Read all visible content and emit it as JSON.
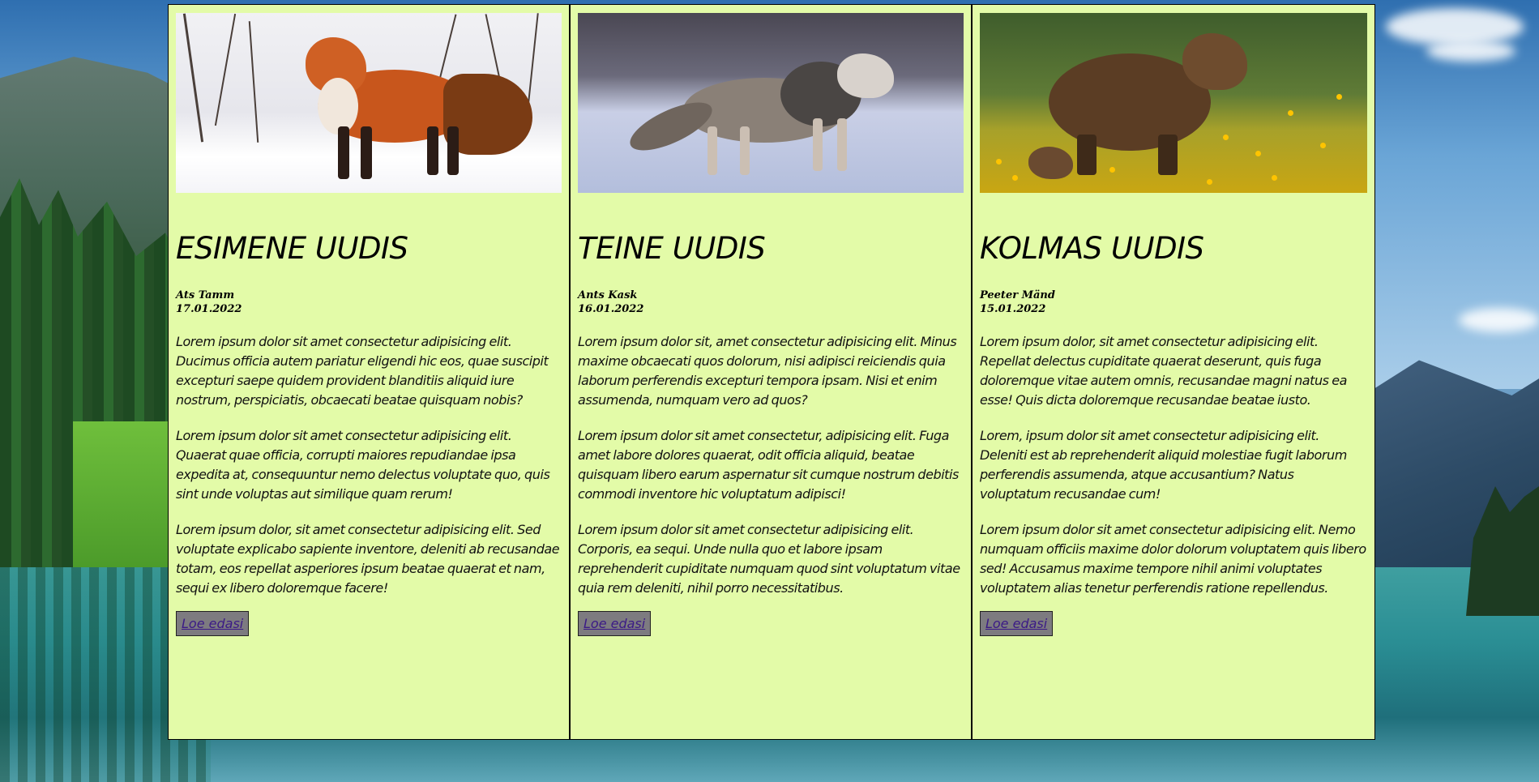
{
  "articles": [
    {
      "image": "fox-photo",
      "title": "ESIMENE UUDIS",
      "author": "Ats Tamm",
      "date": "17.01.2022",
      "paragraphs": [
        "Lorem ipsum dolor sit amet consectetur adipisicing elit. Ducimus officia autem pariatur eligendi hic eos, quae suscipit excepturi saepe quidem provident blanditiis aliquid iure nostrum, perspiciatis, obcaecati beatae quisquam nobis?",
        "Lorem ipsum dolor sit amet consectetur adipisicing elit. Quaerat quae officia, corrupti maiores repudiandae ipsa expedita at, consequuntur nemo delectus voluptate quo, quis sint unde voluptas aut similique quam rerum!",
        "Lorem ipsum dolor, sit amet consectetur adipisicing elit. Sed voluptate explicabo sapiente inventore, deleniti ab recusandae totam, eos repellat asperiores ipsum beatae quaerat et nam, sequi ex libero doloremque facere!"
      ],
      "read_more": "Loe edasi"
    },
    {
      "image": "wolf-photo",
      "title": "TEINE UUDIS",
      "author": "Ants Kask",
      "date": "16.01.2022",
      "paragraphs": [
        "Lorem ipsum dolor sit, amet consectetur adipisicing elit. Minus maxime obcaecati quos dolorum, nisi adipisci reiciendis quia laborum perferendis excepturi tempora ipsam. Nisi et enim assumenda, numquam vero ad quos?",
        "Lorem ipsum dolor sit amet consectetur, adipisicing elit. Fuga amet labore dolores quaerat, odit officia aliquid, beatae quisquam libero earum aspernatur sit cumque nostrum debitis commodi inventore hic voluptatum adipisci!",
        "Lorem ipsum dolor sit amet consectetur adipisicing elit. Corporis, ea sequi. Unde nulla quo et labore ipsam reprehenderit cupiditate numquam quod sint voluptatum vitae quia rem deleniti, nihil porro necessitatibus."
      ],
      "read_more": "Loe edasi"
    },
    {
      "image": "bear-photo",
      "title": "KOLMAS UUDIS",
      "author": "Peeter Mänd",
      "date": "15.01.2022",
      "paragraphs": [
        "Lorem ipsum dolor, sit amet consectetur adipisicing elit. Repellat delectus cupiditate quaerat deserunt, quis fuga doloremque vitae autem omnis, recusandae magni natus ea esse! Quis dicta doloremque recusandae beatae iusto.",
        "Lorem, ipsum dolor sit amet consectetur adipisicing elit. Deleniti est ab reprehenderit aliquid molestiae fugit laborum perferendis assumenda, atque accusantium? Natus voluptatum recusandae cum!",
        "Lorem ipsum dolor sit amet consectetur adipisicing elit. Nemo numquam officiis maxime dolor dolorum voluptatem quis libero sed! Accusamus maxime tempore nihil animi voluptates voluptatem alias tenetur perferendis ratione repellendus."
      ],
      "read_more": "Loe edasi"
    }
  ],
  "colors": {
    "card_background": "#e3fba8",
    "button_background": "#7d7b80",
    "link_color": "#3b1a86"
  }
}
